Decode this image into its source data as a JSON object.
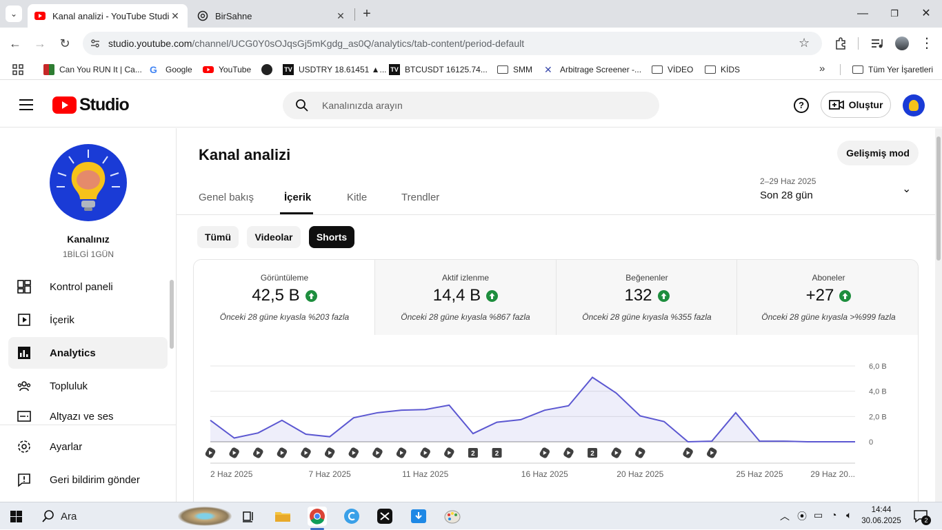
{
  "browser": {
    "tabs": [
      {
        "title": "Kanal analizi - YouTube Studio",
        "active": true
      },
      {
        "title": "BirSahne",
        "active": false
      }
    ],
    "url_host": "studio.youtube.com",
    "url_path": "/channel/UCG0Y0sOJqsGj5mKgdg_as0Q/analytics/tab-content/period-default",
    "bookmarks": [
      "Can You RUN It | Ca...",
      "Google",
      "YouTube",
      "",
      "USDTRY 18.61451 ▲...",
      "BTCUSDT 16125.74...",
      "SMM",
      "Arbitrage Screener -...",
      "VİDEO",
      "KİDS"
    ],
    "all_bookmarks": "Tüm Yer İşaretleri"
  },
  "studio": {
    "logo_text": "Studio",
    "search_placeholder": "Kanalınızda arayın",
    "create_label": "Oluştur"
  },
  "sidebar": {
    "channel_title": "Kanalınız",
    "channel_name": "1BİLGİ 1GÜN",
    "items": [
      {
        "label": "Kontrol paneli",
        "icon": "dashboard-icon"
      },
      {
        "label": "İçerik",
        "icon": "content-icon"
      },
      {
        "label": "Analytics",
        "icon": "analytics-icon",
        "active": true
      },
      {
        "label": "Topluluk",
        "icon": "community-icon"
      },
      {
        "label": "Altyazı ve ses",
        "icon": "subtitles-icon"
      }
    ],
    "bottom_items": [
      {
        "label": "Ayarlar",
        "icon": "settings-icon"
      },
      {
        "label": "Geri bildirim gönder",
        "icon": "feedback-icon"
      }
    ]
  },
  "main": {
    "title": "Kanal analizi",
    "advanced_mode": "Gelişmiş mod",
    "tabs": [
      "Genel bakış",
      "İçerik",
      "Kitle",
      "Trendler"
    ],
    "active_tab": 1,
    "date_range": "2–29 Haz 2025",
    "period": "Son 28 gün",
    "chips": [
      "Tümü",
      "Videolar",
      "Shorts"
    ],
    "active_chip": 2,
    "metrics": [
      {
        "label": "Görüntüleme",
        "value": "42,5 B",
        "compare": "Önceki 28 güne kıyasla %203 fazla"
      },
      {
        "label": "Aktif izlenme",
        "value": "14,4 B",
        "compare": "Önceki 28 güne kıyasla %867 fazla"
      },
      {
        "label": "Beğenenler",
        "value": "132",
        "compare": "Önceki 28 güne kıyasla %355 fazla"
      },
      {
        "label": "Aboneler",
        "value": "+27",
        "compare": "Önceki 28 güne kıyasla >%999 fazla"
      }
    ]
  },
  "chart_data": {
    "type": "area",
    "yticks": [
      "6,0 B",
      "4,0 B",
      "2,0 B",
      "0"
    ],
    "ylim": [
      0,
      6000
    ],
    "x": [
      "2 Haz",
      "3 Haz",
      "4 Haz",
      "5 Haz",
      "6 Haz",
      "7 Haz",
      "8 Haz",
      "9 Haz",
      "10 Haz",
      "11 Haz",
      "12 Haz",
      "13 Haz",
      "14 Haz",
      "15 Haz",
      "16 Haz",
      "17 Haz",
      "18 Haz",
      "19 Haz",
      "20 Haz",
      "21 Haz",
      "22 Haz",
      "23 Haz",
      "24 Haz",
      "25 Haz",
      "26 Haz",
      "27 Haz",
      "28 Haz",
      "29 Haz"
    ],
    "values": [
      1700,
      300,
      700,
      1700,
      600,
      400,
      1900,
      2300,
      2500,
      2550,
      2900,
      650,
      1550,
      1750,
      2500,
      2850,
      5100,
      3850,
      2050,
      1600,
      0,
      50,
      2300,
      50,
      50,
      0,
      0,
      0
    ],
    "xtick_labels": [
      "2 Haz 2025",
      "7 Haz 2025",
      "11 Haz 2025",
      "16 Haz 2025",
      "20 Haz 2025",
      "25 Haz 2025",
      "29 Haz 20..."
    ],
    "xtick_index": [
      0,
      5,
      9,
      14,
      18,
      23,
      27
    ],
    "markers": [
      "s",
      "s",
      "s",
      "s",
      "s",
      "s",
      "s",
      "s",
      "s",
      "s",
      "s",
      "2",
      "2",
      "",
      "s",
      "s",
      "2",
      "s",
      "s",
      "",
      "s",
      "s",
      "",
      "",
      "",
      "",
      "",
      ""
    ],
    "color": "#5b57d1"
  },
  "taskbar": {
    "search_label": "Ara",
    "time": "14:44",
    "date": "30.06.2025",
    "notifications": "2"
  }
}
